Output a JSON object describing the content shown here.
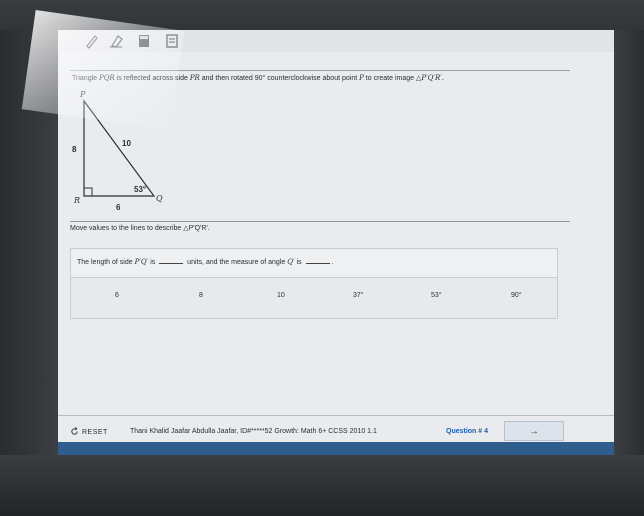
{
  "toolbar": {
    "tools": [
      "pencil-icon",
      "eraser-icon",
      "calculator-icon",
      "notepad-icon"
    ]
  },
  "question": {
    "prefix": "Triangle",
    "triangle_name": "PQR",
    "mid1": "is reflected across side",
    "side": "PR",
    "mid2": "and then rotated",
    "angle": "90°",
    "mid3": "counterclockwise about point",
    "point": "P",
    "mid4": "to create image",
    "image_name": "△P′Q′R′."
  },
  "figure": {
    "vertex_p": "P",
    "vertex_q": "Q",
    "vertex_r": "R",
    "side_pr": "8",
    "side_pq": "10",
    "side_rq": "6",
    "angle_q": "53°"
  },
  "instruction": "Move values to the lines to describe △P′Q′R′.",
  "sentence": {
    "part1": "The length of side",
    "side": "P′Q′",
    "part2": "is",
    "part3": "units, and the measure of angle",
    "angle": "Q′",
    "part4": "is",
    "part5": "."
  },
  "options": [
    "6",
    "8",
    "10",
    "37°",
    "53°",
    "90°"
  ],
  "footer": {
    "reset_label": "RESET",
    "info": "Thani Khalid Jaafar Abdulla Jaafar, ID#*****52  Growth: Math 6+ CCSS 2010 1.1",
    "question_label": "Question # 4",
    "next_arrow": "→"
  },
  "colors": {
    "accent_blue": "#1f5fa8",
    "bottom_bar": "#2f5e8e",
    "screen_bg": "#e9ebee"
  }
}
